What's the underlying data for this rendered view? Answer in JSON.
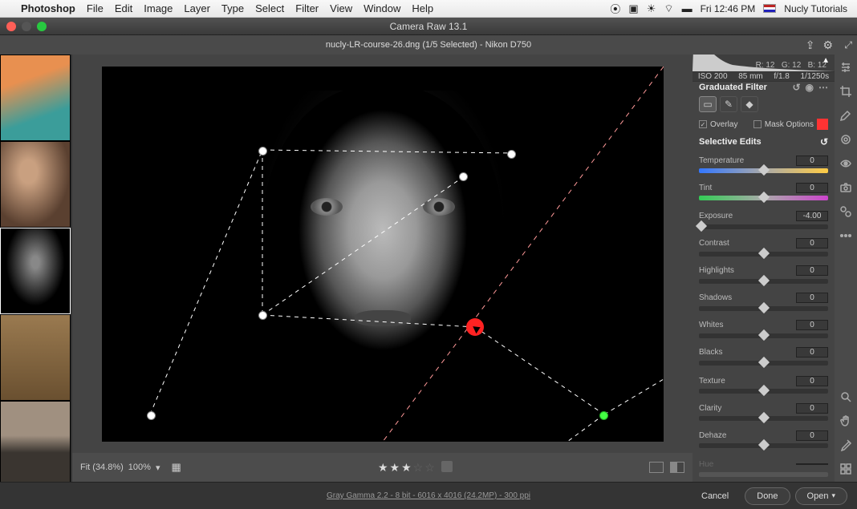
{
  "menubar": {
    "app": "Photoshop",
    "items": [
      "File",
      "Edit",
      "Image",
      "Layer",
      "Type",
      "Select",
      "Filter",
      "View",
      "Window",
      "Help"
    ],
    "time": "Fri 12:46 PM",
    "user": "Nucly Tutorials"
  },
  "window": {
    "title": "Camera Raw 13.1"
  },
  "subheader": {
    "filename": "nucly-LR-course-26.dng (1/5 Selected)  -  Nikon D750"
  },
  "histogram": {
    "r": "R: 12",
    "g": "G: 12",
    "b": "B: 12"
  },
  "exif": {
    "iso": "ISO 200",
    "focal": "85 mm",
    "aperture": "f/1.8",
    "shutter": "1/1250s"
  },
  "panel_title": "Graduated Filter",
  "overlay_label": "Overlay",
  "mask_options_label": "Mask Options",
  "selective_edits": "Selective Edits",
  "sliders": {
    "temperature": {
      "label": "Temperature",
      "value": "0",
      "pos": 50
    },
    "tint": {
      "label": "Tint",
      "value": "0",
      "pos": 50
    },
    "exposure": {
      "label": "Exposure",
      "value": "-4.00",
      "pos": 2
    },
    "contrast": {
      "label": "Contrast",
      "value": "0",
      "pos": 50
    },
    "highlights": {
      "label": "Highlights",
      "value": "0",
      "pos": 50
    },
    "shadows": {
      "label": "Shadows",
      "value": "0",
      "pos": 50
    },
    "whites": {
      "label": "Whites",
      "value": "0",
      "pos": 50
    },
    "blacks": {
      "label": "Blacks",
      "value": "0",
      "pos": 50
    },
    "texture": {
      "label": "Texture",
      "value": "0",
      "pos": 50
    },
    "clarity": {
      "label": "Clarity",
      "value": "0",
      "pos": 50
    },
    "dehaze": {
      "label": "Dehaze",
      "value": "0",
      "pos": 50
    },
    "hue": {
      "label": "Hue",
      "value": "",
      "pos": 50
    }
  },
  "zoom": {
    "fit": "Fit (34.8%)",
    "hundred": "100%"
  },
  "footer": {
    "info": "Gray Gamma 2.2 - 8 bit - 6016 x 4016 (24.2MP) - 300 ppi",
    "cancel": "Cancel",
    "done": "Done",
    "open": "Open"
  }
}
